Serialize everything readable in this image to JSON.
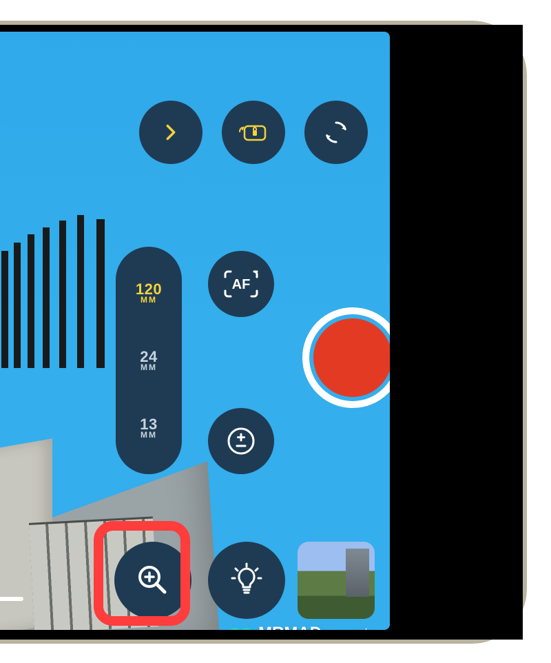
{
  "top_bar": {
    "more_label": "more",
    "rotation_lock_label": "rotation-lock",
    "flip_camera_label": "flip-camera"
  },
  "focal_lengths": [
    {
      "value": "120",
      "unit": "MM",
      "active": true
    },
    {
      "value": "24",
      "unit": "MM",
      "active": false
    },
    {
      "value": "13",
      "unit": "MM",
      "active": false
    }
  ],
  "mid_controls": {
    "autofocus_label": "AF",
    "exposure_label": "exposure"
  },
  "record": {
    "label": "record"
  },
  "bottom_controls": {
    "zoom_label": "zoom",
    "light_label": "light",
    "thumbnail_label": "last-photo-thumbnail"
  },
  "watermark": {
    "brand": "MRMAD",
    "domain": ".com.tw"
  },
  "colors": {
    "button_bg": "#1f3b53",
    "accent_yellow": "#f4d23a",
    "record_red": "#e33a24",
    "highlight_red": "#ff3d3d",
    "sky": "#34aeec"
  }
}
